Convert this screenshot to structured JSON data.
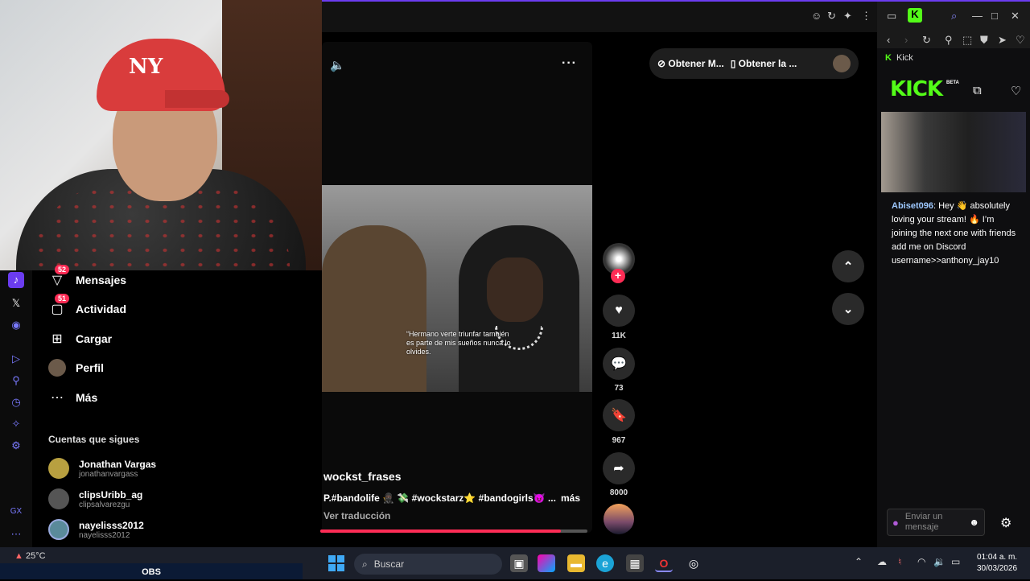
{
  "webcam": {
    "cap_logo": "NY"
  },
  "topbar": {
    "icons": [
      "emoji-icon",
      "reload-icon",
      "extension-icon",
      "menu-dots-icon"
    ]
  },
  "sidebar": {
    "items": [
      {
        "label": "Mensajes",
        "badge": "52"
      },
      {
        "label": "Actividad",
        "badge": "51"
      },
      {
        "label": "Cargar"
      },
      {
        "label": "Perfil"
      },
      {
        "label": "Más"
      }
    ],
    "following_title": "Cuentas que sigues",
    "following": [
      {
        "name": "Jonathan Vargas",
        "handle": "jonathanvargass"
      },
      {
        "name": "clipsUribb_ag",
        "handle": "clipsalvarezgu"
      },
      {
        "name": "nayelisss2012",
        "handle": "nayelisss2012"
      }
    ]
  },
  "video": {
    "caption": "“Hermano verte triunfar también es parte de mis sueños nunca lo olvides.",
    "author": "wockst_frases",
    "description": "P.#bandolife 🥷🏿 💸 #wockstarz⭐ #bandogirls😈 ...",
    "more": "más",
    "translate": "Ver traducción",
    "progress": 0.9
  },
  "actions": {
    "likes": "11K",
    "comments": "73",
    "saves": "967",
    "shares": "8000"
  },
  "getapp": {
    "item1": "Obtener M...",
    "item2": "Obtener la ..."
  },
  "kick": {
    "site_label": "Kick",
    "logo": "KICK",
    "beta": "BETA",
    "chat_user": "Abiset096",
    "chat_text": ": Hey 👋 absolutely loving your stream! 🔥 I’m joining the next one with friends add me on Discord username>>anthony_jay10",
    "input_placeholder": "Enviar un mensaje"
  },
  "taskbar": {
    "weather": "25°C",
    "obs": "OBS",
    "search": "Buscar",
    "time": "01:04 a. m.",
    "date": "30/03/2026"
  },
  "colors": {
    "accent": "#fe2c55",
    "kick_green": "#53fc18",
    "browser_accent": "#6b3cf0"
  }
}
